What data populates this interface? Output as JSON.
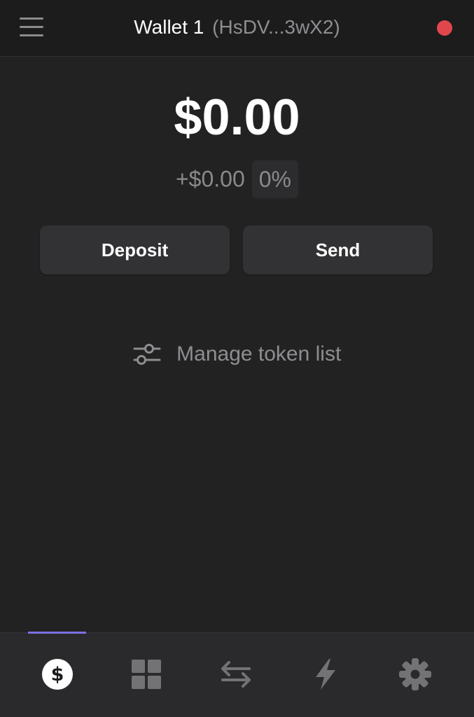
{
  "header": {
    "wallet_name": "Wallet 1",
    "wallet_address": "(HsDV...3wX2)",
    "menu_icon": "hamburger-menu-icon",
    "status_color": "#e0474c"
  },
  "balance": {
    "total": "$0.00",
    "change": "+$0.00",
    "change_percent": "0%"
  },
  "actions": {
    "deposit_label": "Deposit",
    "send_label": "Send"
  },
  "tokens": {
    "manage_label": "Manage token list",
    "manage_icon": "sliders-icon"
  },
  "tabs": {
    "active_color": "#7b6fe6",
    "items": [
      {
        "icon": "dollar-icon",
        "active": true
      },
      {
        "icon": "grid-icon",
        "active": false
      },
      {
        "icon": "swap-arrows-icon",
        "active": false
      },
      {
        "icon": "lightning-icon",
        "active": false
      },
      {
        "icon": "gear-icon",
        "active": false
      }
    ]
  }
}
